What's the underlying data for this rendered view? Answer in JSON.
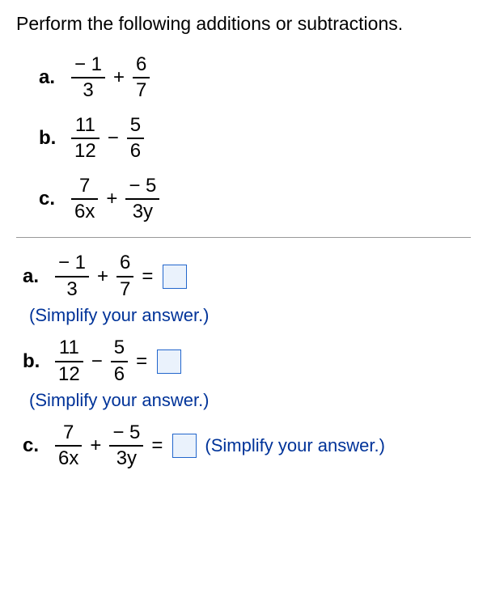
{
  "instruction": "Perform the following additions or subtractions.",
  "problems": {
    "a": {
      "label": "a.",
      "f1": {
        "num": "− 1",
        "den": "3"
      },
      "op": "+",
      "f2": {
        "num": "6",
        "den": "7"
      }
    },
    "b": {
      "label": "b.",
      "f1": {
        "num": "11",
        "den": "12"
      },
      "op": "−",
      "f2": {
        "num": "5",
        "den": "6"
      }
    },
    "c": {
      "label": "c.",
      "f1": {
        "num": "7",
        "den": "6x"
      },
      "op": "+",
      "f2": {
        "num": "− 5",
        "den": "3y"
      }
    }
  },
  "answers": {
    "a": {
      "label": "a.",
      "f1": {
        "num": "− 1",
        "den": "3"
      },
      "op": "+",
      "f2": {
        "num": "6",
        "den": "7"
      },
      "eq": "=",
      "hint": "(Simplify your answer.)"
    },
    "b": {
      "label": "b.",
      "f1": {
        "num": "11",
        "den": "12"
      },
      "op": "−",
      "f2": {
        "num": "5",
        "den": "6"
      },
      "eq": "=",
      "hint": "(Simplify your answer.)"
    },
    "c": {
      "label": "c.",
      "f1": {
        "num": "7",
        "den": "6x"
      },
      "op": "+",
      "f2": {
        "num": "− 5",
        "den": "3y"
      },
      "eq": "=",
      "hint": "(Simplify your answer.)"
    }
  }
}
